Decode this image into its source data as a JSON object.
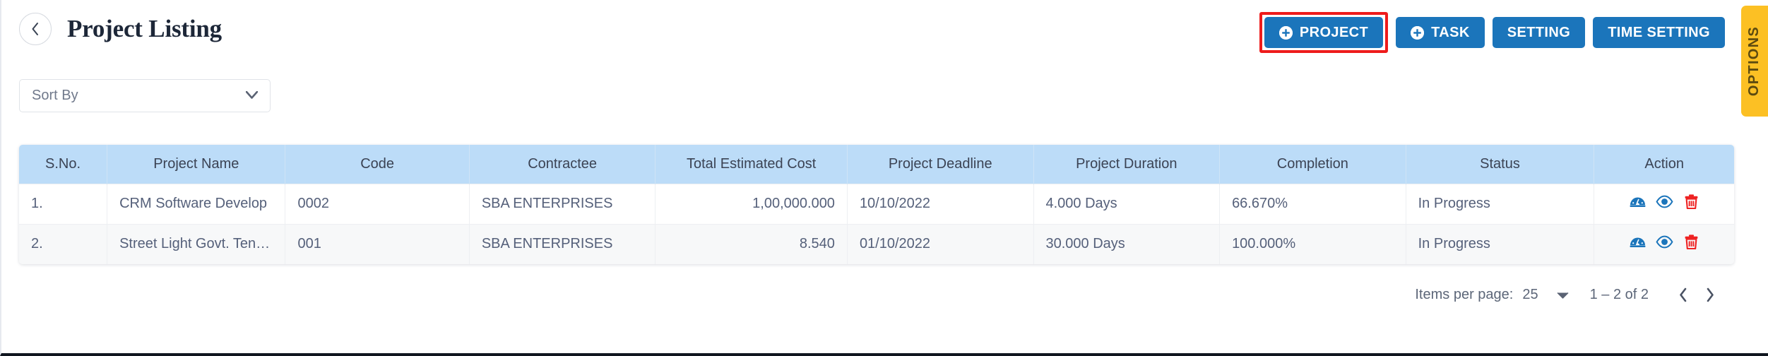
{
  "header": {
    "back_icon": "chevron-left-icon",
    "title": "Project Listing",
    "buttons": [
      {
        "label": "PROJECT",
        "icon": "plus-circle-icon",
        "has_icon": true,
        "highlighted": true
      },
      {
        "label": "TASK",
        "icon": "plus-circle-icon",
        "has_icon": true,
        "highlighted": false
      },
      {
        "label": "SETTING",
        "icon": "",
        "has_icon": false,
        "highlighted": false
      },
      {
        "label": "TIME SETTING",
        "icon": "",
        "has_icon": false,
        "highlighted": false
      }
    ],
    "accent_color": "#1b75bb",
    "highlight_color": "#ee1b1b"
  },
  "options_tab": {
    "label": "OPTIONS",
    "color": "#fcc024"
  },
  "sort_by": {
    "value": "Sort By",
    "caret_icon": "chevron-down-icon"
  },
  "table": {
    "header_color": "#bcdcf8",
    "columns": [
      "S.No.",
      "Project Name",
      "Code",
      "Contractee",
      "Total Estimated Cost",
      "Project Deadline",
      "Project Duration",
      "Completion",
      "Status",
      "Action"
    ],
    "rows": [
      {
        "sno": "1.",
        "project_name": "CRM Software Develop",
        "code": "0002",
        "contractee": "SBA ENTERPRISES",
        "total_estimated_cost": "1,00,000.000",
        "project_deadline": "10/10/2022",
        "project_duration": "4.000 Days",
        "completion": "66.670%",
        "status": "In Progress"
      },
      {
        "sno": "2.",
        "project_name": "Street Light Govt. Tender",
        "code": "001",
        "contractee": "SBA ENTERPRISES",
        "total_estimated_cost": "8.540",
        "project_deadline": "01/10/2022",
        "project_duration": "30.000 Days",
        "completion": "100.000%",
        "status": "In Progress"
      }
    ],
    "action_icons": [
      {
        "name": "dashboard-gauge-icon",
        "color": "#1b75bb"
      },
      {
        "name": "eye-view-icon",
        "color": "#1b75bb"
      },
      {
        "name": "trash-delete-icon",
        "color": "#ee2222"
      }
    ]
  },
  "pagination": {
    "items_per_page_label": "Items per page:",
    "items_per_page_value": "25",
    "caret_icon": "chevron-down-icon",
    "range_label": "1 – 2 of 2",
    "prev_icon": "chevron-left-icon",
    "next_icon": "chevron-right-icon"
  }
}
